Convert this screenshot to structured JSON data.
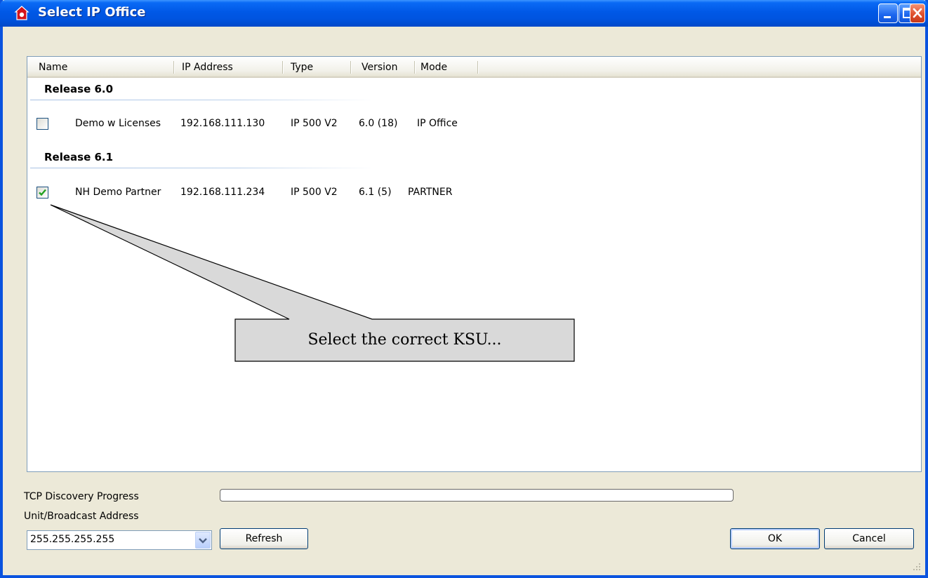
{
  "window": {
    "title": "Select IP Office"
  },
  "columns": [
    "Name",
    "IP Address",
    "Type",
    "Version",
    "Mode"
  ],
  "groups": [
    {
      "label": "Release 6.0",
      "rows": [
        {
          "checked": false,
          "name": "Demo w Licenses",
          "ip": "192.168.111.130",
          "type": "IP 500 V2",
          "version": "6.0 (18)",
          "mode": "IP Office"
        }
      ]
    },
    {
      "label": "Release 6.1",
      "rows": [
        {
          "checked": true,
          "name": "NH Demo Partner",
          "ip": "192.168.111.234",
          "type": "IP 500 V2",
          "version": "6.1 (5)",
          "mode": "PARTNER"
        }
      ]
    }
  ],
  "progress": {
    "label": "TCP Discovery Progress",
    "value": 0
  },
  "address": {
    "label": "Unit/Broadcast Address",
    "value": "255.255.255.255"
  },
  "buttons": {
    "refresh": "Refresh",
    "ok": "OK",
    "cancel": "Cancel"
  },
  "callout": {
    "text": "Select the correct KSU..."
  },
  "colors": {
    "titlebar": "#0054e3",
    "check": "#21a121",
    "close": "#e0512d"
  }
}
